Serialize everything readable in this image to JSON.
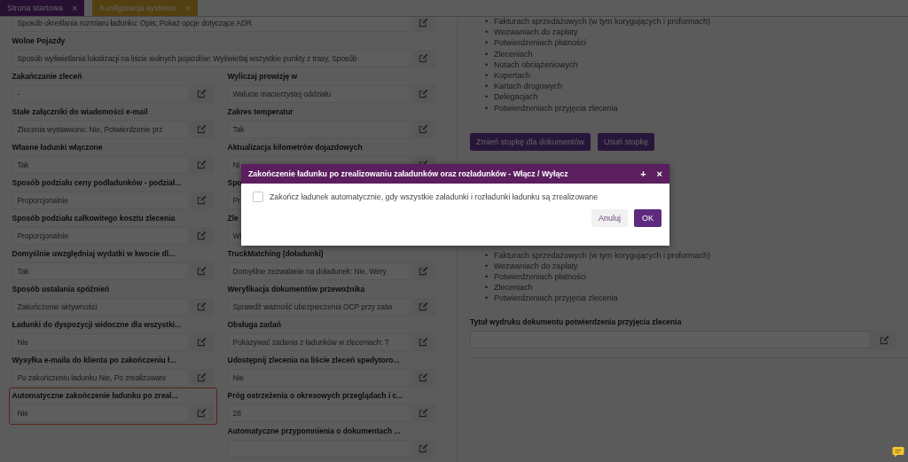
{
  "tabs": [
    {
      "label": "Strona startowa",
      "close": "×",
      "selected": false
    },
    {
      "label": "Konfiguracja systemu",
      "close": "×",
      "selected": true
    }
  ],
  "settings": {
    "rows": [
      {
        "full": {
          "value": "Sposób określania rozmiaru ładunku: Opis; Pokaż opcje dotyczące ADR",
          "highlighted": false
        }
      },
      {
        "full": {
          "label": "Wolne Pojazdy",
          "value": "Sposób wyświetlania lokalizacji na liście wolnych pojazdów: Wyświetlaj wszystkie punkty z trasy, Sposób",
          "highlighted": false
        }
      },
      {
        "left": {
          "label": "Zakańczanie zleceń",
          "value": "-",
          "highlighted": false
        },
        "right": {
          "label": "Wyliczaj prowizję w",
          "value": "Walucie macierzystej oddziału",
          "highlighted": false
        }
      },
      {
        "left": {
          "label": "Stałe załączniki do wiadomości e-mail",
          "value": "Zlecenia wystawione: Nie, Potwierdzenie prz",
          "highlighted": false
        },
        "right": {
          "label": "Zakres temperatur",
          "value": "Tak",
          "highlighted": false
        }
      },
      {
        "left": {
          "label": "Własne ładunki włączone",
          "value": "Tak",
          "highlighted": false
        },
        "right": {
          "label": "Aktualizacja kilometrów dojazdowych",
          "value": "Ni",
          "highlighted": false
        }
      },
      {
        "left": {
          "label": "Sposób podziału ceny podładunków - podział...",
          "value": "Proporcjonalnie",
          "highlighted": false
        },
        "right": {
          "label": "Spo",
          "value": "Pr",
          "highlighted": false
        }
      },
      {
        "left": {
          "label": "Sposób podziału całkowitego kosztu zlecenia",
          "value": "Proporcjonalnie",
          "highlighted": false
        },
        "right": {
          "label": "Zle",
          "value": "Wi",
          "highlighted": false
        }
      },
      {
        "left": {
          "label": "Domyślnie uwzględniaj wydatki w kwocie dl...",
          "value": "Tak",
          "highlighted": false
        },
        "right": {
          "label": "TruckMatching (doładunki)",
          "value": "Domyślne zezwalanie na doładunek: Nie, Wery",
          "highlighted": false
        }
      },
      {
        "left": {
          "label": "Sposób ustalania spóźnień",
          "value": "Zakończenie aktywności",
          "highlighted": false
        },
        "right": {
          "label": "Weryfikacja dokumentów przewoźnika",
          "value": "Sprawdź ważność ubezpieczenia OCP przy zatw",
          "highlighted": false
        }
      },
      {
        "left": {
          "label": "Ładunki do dyspozycji widoczne dla wszystki...",
          "value": "Nie",
          "highlighted": false
        },
        "right": {
          "label": "Obsługa zadań",
          "value": "Pokazywać zadania z ładunków w zleceniach: T",
          "highlighted": false
        }
      },
      {
        "left": {
          "label": "Wysyłka e-maila do klienta po zakończeniu ł...",
          "value": "Po zakończeniu ładunku Nie, Po zrealizowani",
          "highlighted": false
        },
        "right": {
          "label": "Udostępnij zlecenia na liście zleceń spedytoro...",
          "value": "Nie",
          "highlighted": false
        }
      },
      {
        "left": {
          "label": "Automatyczne zakończenie ładunku po zreal...",
          "value": "Nie",
          "highlighted": true
        },
        "right": {
          "label": "Próg ostrzeżenia o okresowych przeglądach i c...",
          "value": "28",
          "highlighted": false
        }
      },
      {
        "right": {
          "label": "Automatyczne przypomnienia o dokumentach ...",
          "highlighted": false
        }
      }
    ]
  },
  "footer_panel": {
    "bullet": "•",
    "documents": [
      "Fakturach sprzedażowych (w tym korygujących i proformach)",
      "Wezwaniach do zapłaty",
      "Potwierdzeniach płatności",
      "Zleceniach",
      "Notach obciążeniowych",
      "Kopertach",
      "Kartach drogowych",
      "Delegacjach",
      "Potwierdzeniach przyjęcia zlecenia"
    ],
    "buttons": [
      "Zmień stopkę dla dokumentów",
      "Usuń stopkę"
    ],
    "documents_2": [
      "Fakturach sprzedażowych (w tym korygujących i proformach)",
      "Wezwaniach do zapłaty",
      "Potwierdzeniach płatności",
      "Zleceniach",
      "Potwierdzeniach przyjęcia zlecenia"
    ],
    "print_title": {
      "label": "Tytuł wydruku dokumentu potwierdzenia przyjęcia zlecenia"
    }
  },
  "dialog": {
    "title": "Zakończenie ładunku po zrealizowaniu załadunków oraz rozładunków - Włącz / Wyłącz",
    "actions": [
      "+",
      "×"
    ],
    "checkbox": {
      "label": "Zakończ ładunek automatycznie, gdy wszystkie załadunki i rozładunki ładunku są zrealizowane",
      "checked": false
    },
    "buttons": [
      {
        "label": "Anuluj",
        "kind": "secondary"
      },
      {
        "label": "OK",
        "kind": "primary"
      }
    ]
  }
}
